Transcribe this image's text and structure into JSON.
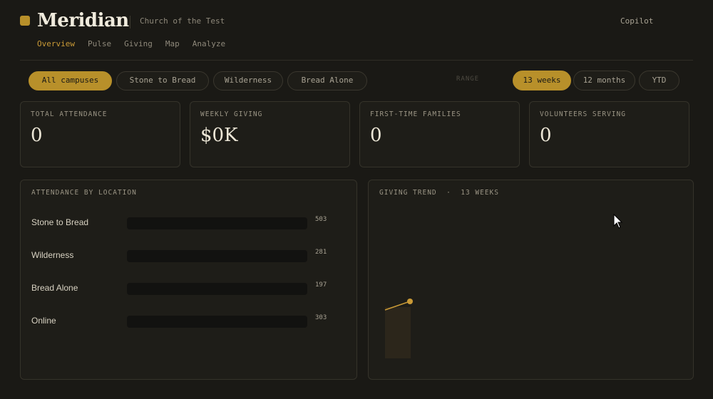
{
  "header": {
    "brand": "Meridian",
    "church": "Church of the Test",
    "copilot": "Copilot"
  },
  "nav": [
    {
      "label": "Overview",
      "active": true
    },
    {
      "label": "Pulse",
      "active": false
    },
    {
      "label": "Giving",
      "active": false
    },
    {
      "label": "Map",
      "active": false
    },
    {
      "label": "Analyze",
      "active": false
    }
  ],
  "campus_filters": [
    {
      "label": "All campuses",
      "active": true
    },
    {
      "label": "Stone to Bread",
      "active": false
    },
    {
      "label": "Wilderness",
      "active": false
    },
    {
      "label": "Bread Alone",
      "active": false
    }
  ],
  "range": {
    "label": "RANGE",
    "options": [
      {
        "label": "13 weeks",
        "active": true
      },
      {
        "label": "12 months",
        "active": false
      },
      {
        "label": "YTD",
        "active": false
      }
    ]
  },
  "kpis": [
    {
      "label": "TOTAL ATTENDANCE",
      "value": "0"
    },
    {
      "label": "WEEKLY GIVING",
      "value": "$0K"
    },
    {
      "label": "FIRST-TIME FAMILIES",
      "value": "0"
    },
    {
      "label": "VOLUNTEERS SERVING",
      "value": "0"
    }
  ],
  "attendance_panel": {
    "title": "ATTENDANCE BY LOCATION",
    "rows": [
      {
        "name": "Stone to Bread",
        "count": "503",
        "fill_fraction": 0
      },
      {
        "name": "Wilderness",
        "count": "281",
        "fill_fraction": 0
      },
      {
        "name": "Bread Alone",
        "count": "197",
        "fill_fraction": 0
      },
      {
        "name": "Online",
        "count": "303",
        "fill_fraction": 0
      }
    ]
  },
  "giving_panel": {
    "title": "GIVING TREND  ·  13 WEEKS"
  },
  "colors": {
    "accent": "#b8902a",
    "background": "#1a1915",
    "card": "#1e1d18"
  }
}
